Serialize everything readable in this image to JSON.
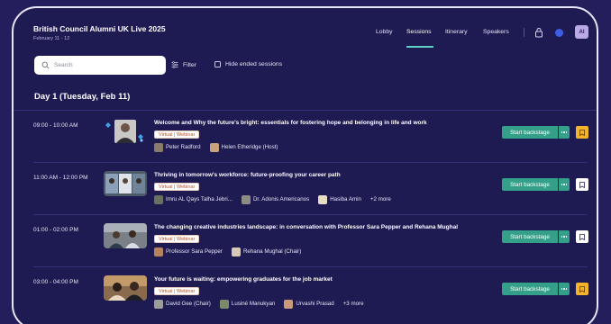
{
  "header": {
    "event_title": "British Council Alumni UK Live 2025",
    "event_date": "February 11 - 12",
    "nav": [
      "Lobby",
      "Sessions",
      "Itinerary",
      "Speakers"
    ],
    "active_nav": "Sessions",
    "avatar_initials": "AI"
  },
  "toolbar": {
    "search_placeholder": "Search",
    "filter_label": "Filter",
    "hide_ended_label": "Hide ended sessions"
  },
  "day": {
    "heading": "Day 1  (Tuesday, Feb 11)"
  },
  "sessions": [
    {
      "time": "09:00 - 10:00 AM",
      "title": "Welcome and Why the future's bright: essentials for fostering hope and belonging in life and work",
      "tag": "Virtual | Webinar",
      "people": [
        "Peter Radford",
        "Helen Etheridge (Host)"
      ],
      "more": "",
      "backstage_label": "Start backstage",
      "bookmarked": true
    },
    {
      "time": "11:00 AM - 12:00 PM",
      "title": "Thriving in tomorrow's workforce: future-proofing your career path",
      "tag": "Virtual | Webinar",
      "people": [
        "Imru AL Qays Talha Jebri...",
        "Dr. Adonis Americanos",
        "Hasiba Amin"
      ],
      "more": "+2 more",
      "backstage_label": "Start backstage",
      "bookmarked": false
    },
    {
      "time": "01:00 - 02:00 PM",
      "title": "The changing creative industries landscape: in conversation with Professor Sara Pepper and Rehana Mughal",
      "tag": "Virtual | Webinar",
      "people": [
        "Professor Sara Pepper",
        "Rehana Mughal (Chair)"
      ],
      "more": "",
      "backstage_label": "Start backstage",
      "bookmarked": false
    },
    {
      "time": "03:00 - 04:00 PM",
      "title": "Your future is waiting: empowering graduates for the job market",
      "tag": "Virtual | Webinar",
      "people": [
        "David Gee (Chair)",
        "Lusiné Manukyan",
        "Urvashi Prasad"
      ],
      "more": "+3 more",
      "backstage_label": "Start backstage",
      "bookmarked": true
    }
  ],
  "colors": {
    "background": "#1e1a52",
    "accent_green": "#35a089",
    "bookmark_active": "#f3b42b",
    "nav_underline": "#5fd0c5",
    "tag_text": "#b0542a"
  }
}
